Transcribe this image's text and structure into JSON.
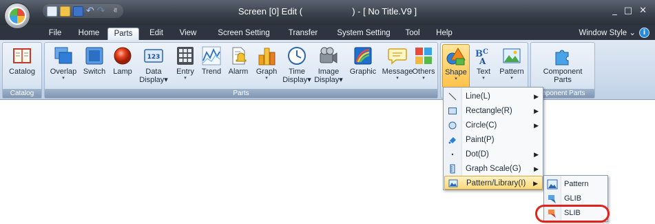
{
  "titlebar": {
    "title": "Screen [0] Edit (                    ) - [ No Title.V9 ]",
    "minimize": "_",
    "maximize": "□",
    "close": "✕",
    "qat_more": "⋷"
  },
  "tabs": [
    "File",
    "Home",
    "Parts",
    "Edit",
    "View",
    "Screen Setting",
    "Transfer",
    "System Setting",
    "Tool",
    "Help"
  ],
  "active_tab": "Parts",
  "window_style": "Window Style ⌄",
  "help": "i",
  "ribbon": {
    "catalog_group": {
      "label": "Catalog",
      "button": "Catalog"
    },
    "parts_group": {
      "label": "Parts",
      "buttons": {
        "overlap": "Overlap",
        "switch": "Switch",
        "lamp": "Lamp",
        "data_display_1": "Data",
        "data_display_2": "Display",
        "entry": "Entry",
        "trend": "Trend",
        "alarm": "Alarm",
        "graph": "Graph",
        "time_display_1": "Time",
        "time_display_2": "Display",
        "image_display_1": "Image",
        "image_display_2": "Display",
        "graphic": "Graphic",
        "message": "Message",
        "others": "Others"
      }
    },
    "shape_group": {
      "shape": "Shape",
      "text": "Text",
      "pattern": "Pattern"
    },
    "component_group": {
      "label": "mponent Parts",
      "button_1": "Component",
      "button_2": "Parts"
    },
    "arrow": "▾",
    "data_display_icon": "123"
  },
  "shape_menu": {
    "items": [
      {
        "label": "Line(L)",
        "submenu": true
      },
      {
        "label": "Rectangle(R)",
        "submenu": true
      },
      {
        "label": "Circle(C)",
        "submenu": true
      },
      {
        "label": "Paint(P)",
        "submenu": false
      },
      {
        "label": "Dot(D)",
        "submenu": true
      },
      {
        "label": "Graph Scale(G)",
        "submenu": true
      },
      {
        "label": "Pattern/Library(I)",
        "submenu": true
      }
    ],
    "arrow": "▶"
  },
  "library_submenu": {
    "items": [
      "Pattern",
      "GLIB",
      "SLIB"
    ],
    "highlighted": "SLIB"
  }
}
